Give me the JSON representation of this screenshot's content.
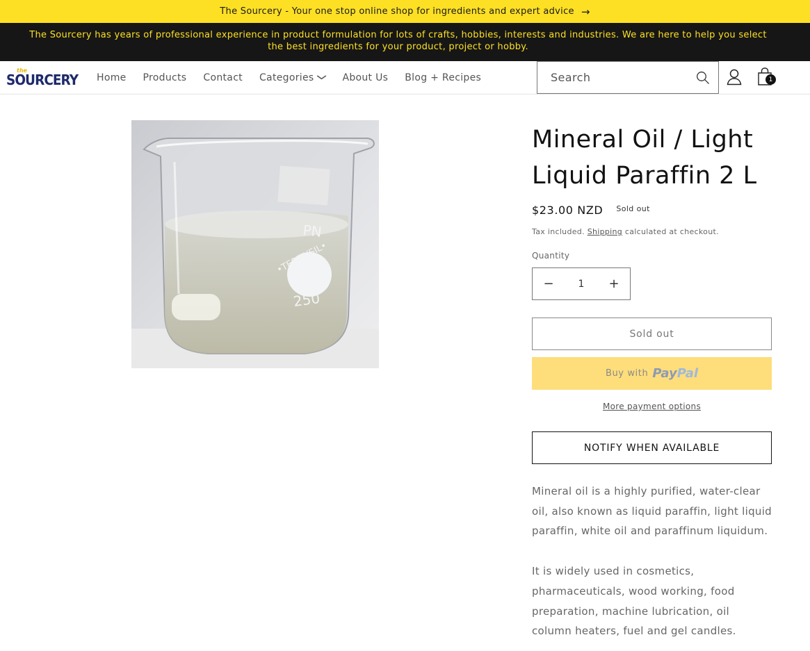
{
  "announcement": {
    "text": "The Sourcery - Your one stop online shop for ingredients and expert advice",
    "arrow": "→"
  },
  "info_bar": {
    "text": "The Sourcery has years of professional experience in product formulation for lots of crafts, hobbies, interests and industries. We are here to help you select the best ingredients for your product, project or hobby."
  },
  "logo": {
    "small": "the",
    "word": "SOURCERY"
  },
  "nav": {
    "home": "Home",
    "products": "Products",
    "contact": "Contact",
    "categories": "Categories",
    "about": "About Us",
    "blog": "Blog + Recipes"
  },
  "search": {
    "placeholder": "Search"
  },
  "cart": {
    "count": "1"
  },
  "product": {
    "title": "Mineral Oil / Light Liquid Paraffin 2 L",
    "price": "$23.00 NZD",
    "badge": "Sold out",
    "tax_prefix": "Tax included.",
    "tax_link": "Shipping",
    "tax_suffix": "calculated at checkout.",
    "quantity_label": "Quantity",
    "quantity_value": "1",
    "minus": "−",
    "plus": "+",
    "soldout_button": "Sold out",
    "paypal_prefix": "Buy with",
    "paypal_pay": "Pay",
    "paypal_pal": "Pal",
    "more_payment": "More payment options",
    "notify_button": "NOTIFY WHEN AVAILABLE",
    "description": [
      "Mineral oil is a highly purified, water-clear oil, also known as liquid paraffin, light liquid paraffin, white oil and paraffinum liquidum.",
      "It is widely used in cosmetics, pharmaceuticals, wood working, food preparation, machine lubrication, oil column heaters, fuel and gel candles."
    ],
    "beaker_markings": {
      "top": "PN",
      "middle": "•TERMYSIL•",
      "volume": "250"
    }
  },
  "colors": {
    "announcement_bg": "#fde024",
    "info_bg": "#161616",
    "info_text": "#fde024",
    "paypal_bg": "#fedd7b"
  }
}
